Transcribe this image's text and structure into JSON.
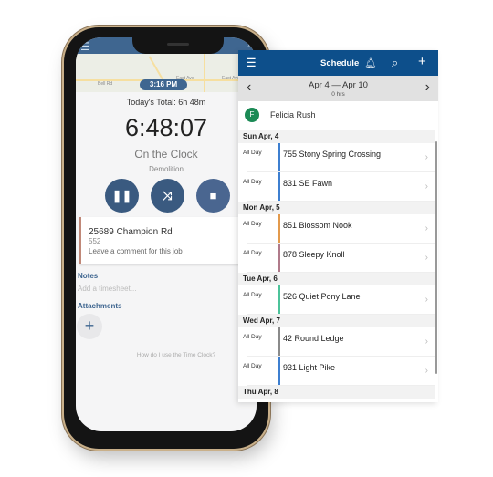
{
  "time_clock": {
    "current_time": "3:16 PM",
    "todays_total": "Today's Total: 6h 48m",
    "elapsed": "6:48:07",
    "status": "On the Clock",
    "task": "Demolition",
    "map_labels": [
      "East Ave",
      "East Ave",
      "Bell Rd"
    ],
    "job": {
      "address": "25689 Champion Rd",
      "number": "552",
      "comment_prompt": "Leave a comment for this job",
      "accent": "#c08878"
    },
    "notes_label": "Notes",
    "notes_placeholder": "Add a timesheet...",
    "attachments_label": "Attachments",
    "help_link": "How do I use the Time Clock?",
    "accent": "#3f6690"
  },
  "schedule": {
    "title": "Schedule",
    "date_range": "Apr 4 — Apr 10",
    "hours": "0 hrs",
    "user": {
      "initial": "F",
      "name": "Felicia Rush"
    },
    "header_color": "#0d4f8b",
    "days": [
      {
        "label": "Sun Apr, 4",
        "items": [
          {
            "time": "All Day",
            "name": "755 Stony Spring Crossing",
            "color": "#3d7fd0"
          },
          {
            "time": "All Day",
            "name": "831 SE Fawn",
            "color": "#3d7fd0"
          }
        ]
      },
      {
        "label": "Mon Apr, 5",
        "items": [
          {
            "time": "All Day",
            "name": "851 Blossom Nook",
            "color": "#e39a4c"
          },
          {
            "time": "All Day",
            "name": "878 Sleepy Knoll",
            "color": "#b07a8a"
          }
        ]
      },
      {
        "label": "Tue Apr, 6",
        "items": [
          {
            "time": "All Day",
            "name": "526 Quiet Pony Lane",
            "color": "#4cc39a"
          }
        ]
      },
      {
        "label": "Wed Apr, 7",
        "items": [
          {
            "time": "All Day",
            "name": "42 Round Ledge",
            "color": "#8a8a8a"
          },
          {
            "time": "All Day",
            "name": "931 Light Pike",
            "color": "#3d7fd0"
          }
        ]
      },
      {
        "label": "Thu Apr, 8",
        "items": []
      }
    ]
  }
}
